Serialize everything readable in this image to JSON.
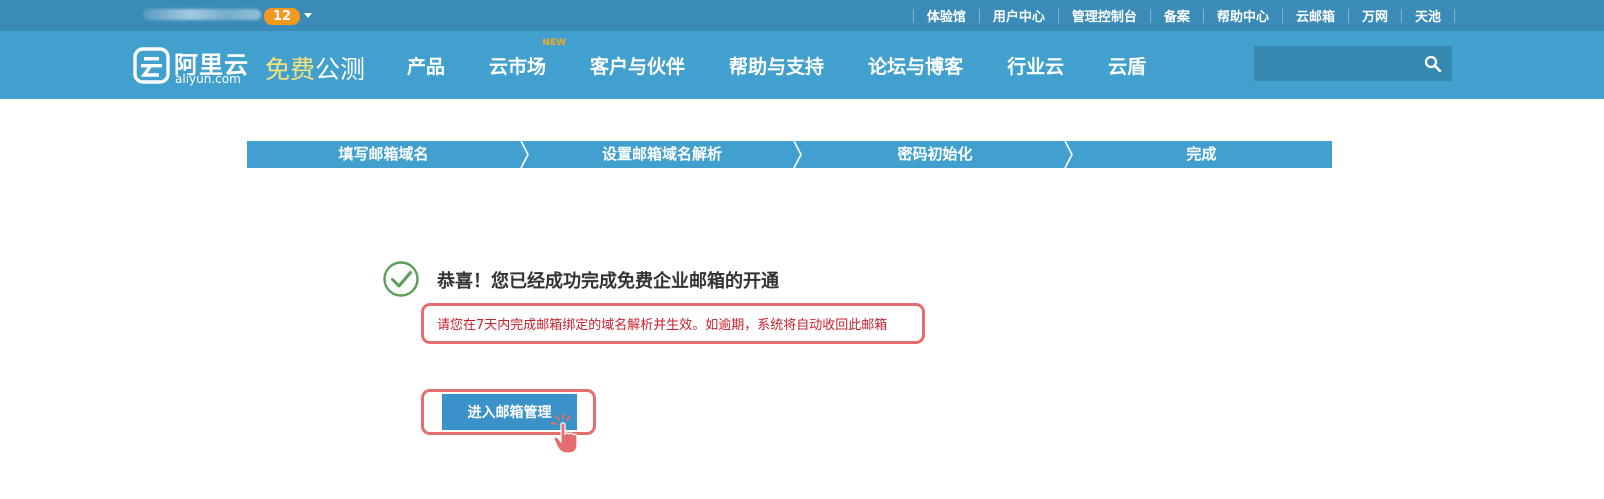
{
  "topbar": {
    "user_badge_count": "12",
    "links": [
      "体验馆",
      "用户中心",
      "管理控制台",
      "备案",
      "帮助中心",
      "云邮箱",
      "万网",
      "天池"
    ]
  },
  "logo": {
    "cn": "阿里云",
    "en": "aliyun.com"
  },
  "beta": {
    "free": "免费",
    "test": "公测"
  },
  "nav": {
    "items": [
      "产品",
      "云市场",
      "客户与伙伴",
      "帮助与支持",
      "论坛与博客",
      "行业云",
      "云盾"
    ],
    "new_tag": "NEW"
  },
  "steps": [
    "填写邮箱域名",
    "设置邮箱域名解析",
    "密码初始化",
    "完成"
  ],
  "success": {
    "title": "恭喜！您已经成功完成免费企业邮箱的开通",
    "notice": "请您在7天内完成邮箱绑定的域名解析并生效。如逾期，系统将自动收回此邮箱",
    "button": "进入邮箱管理"
  },
  "colors": {
    "topbar": "#3a8bb8",
    "navbar": "#41a0ce",
    "badge": "#f39a1e",
    "highlight": "#e46e6e",
    "notice_text": "#c6202c",
    "check": "#5b9e5a"
  },
  "icons": [
    "logo-icon",
    "caret-down-icon",
    "search-icon",
    "check-circle-icon",
    "hand-cursor-icon"
  ]
}
